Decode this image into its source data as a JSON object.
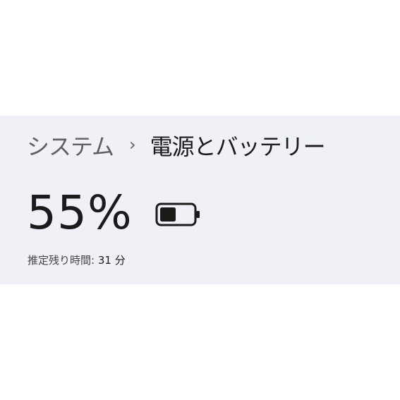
{
  "breadcrumb": {
    "parent": "システム",
    "separator": "›",
    "current": "電源とバッテリー"
  },
  "battery": {
    "percent_text": "55%",
    "level": 0.55,
    "icon": "battery-icon",
    "estimate_label": "推定残り時間:",
    "estimate_value": "31 分"
  },
  "colors": {
    "panel_bg": "#f0f1f6",
    "text_primary": "#1b1b1b",
    "text_secondary": "#5f5f5f"
  }
}
